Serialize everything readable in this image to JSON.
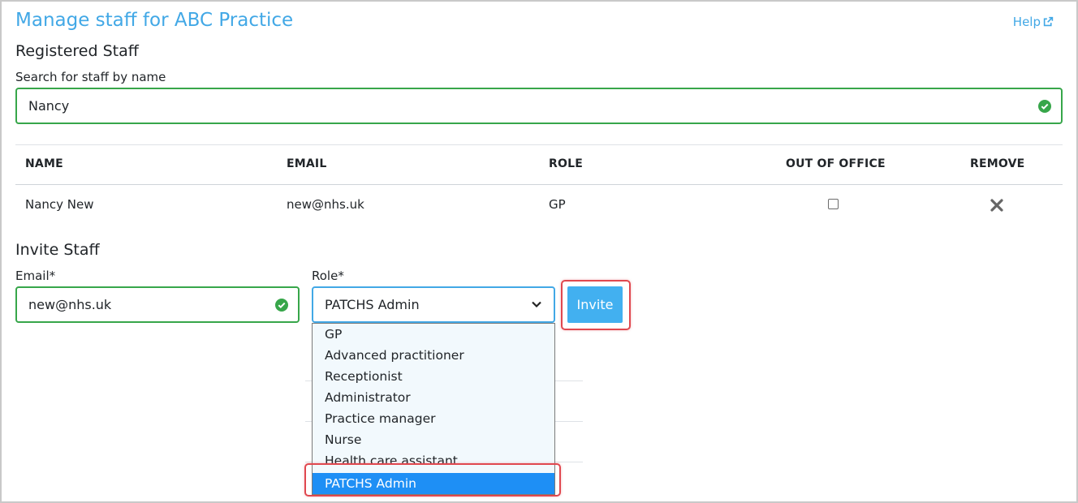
{
  "page": {
    "title": "Manage staff for ABC Practice",
    "help_label": "Help"
  },
  "registered": {
    "section_title": "Registered Staff",
    "search_label": "Search for staff by name",
    "search_value": "Nancy"
  },
  "table": {
    "headers": {
      "name": "NAME",
      "email": "EMAIL",
      "role": "ROLE",
      "out_of_office": "OUT OF OFFICE",
      "remove": "REMOVE"
    },
    "rows": [
      {
        "name": "Nancy New",
        "email": "new@nhs.uk",
        "role": "GP",
        "out_of_office": false
      }
    ]
  },
  "invite": {
    "section_title": "Invite Staff",
    "email_label": "Email*",
    "email_value": "new@nhs.uk",
    "role_label": "Role*",
    "role_value": "PATCHS Admin",
    "button_label": "Invite"
  },
  "role_options": [
    "GP",
    "Advanced practitioner",
    "Receptionist",
    "Administrator",
    "Practice manager",
    "Nurse",
    "Health care assistant",
    "PATCHS Admin"
  ],
  "selected_role_index": 7,
  "colors": {
    "accent": "#42a8e6",
    "valid_green": "#37a64a",
    "highlight_red": "#e0484f",
    "selected_blue": "#1e8ff5"
  }
}
